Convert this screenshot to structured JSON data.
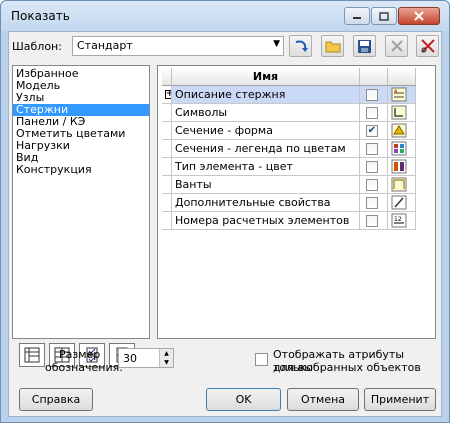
{
  "window": {
    "title": "Показать"
  },
  "template": {
    "label": "Шаблон:",
    "value": "Стандарт"
  },
  "categories": [
    {
      "label": "Избранное",
      "selected": false
    },
    {
      "label": "Модель",
      "selected": false
    },
    {
      "label": "Узлы",
      "selected": false
    },
    {
      "label": "Стержни",
      "selected": true
    },
    {
      "label": "Панели / КЭ",
      "selected": false
    },
    {
      "label": "Отметить цветами",
      "selected": false
    },
    {
      "label": "Нагрузки",
      "selected": false
    },
    {
      "label": "Вид",
      "selected": false
    },
    {
      "label": "Конструкция",
      "selected": false
    }
  ],
  "grid": {
    "header": "Имя",
    "rows": [
      {
        "name": "Описание стержня",
        "checked": false,
        "icon": "bar-description-icon",
        "expandable": true,
        "selected": true
      },
      {
        "name": "Символы",
        "checked": false,
        "icon": "symbols-icon",
        "expandable": false,
        "selected": false
      },
      {
        "name": "Сечение - форма",
        "checked": true,
        "icon": "section-shape-icon",
        "expandable": false,
        "selected": false
      },
      {
        "name": "Сечения - легенда по цветам",
        "checked": false,
        "icon": "section-color-legend-icon",
        "expandable": false,
        "selected": false
      },
      {
        "name": "Тип элемента - цвет",
        "checked": false,
        "icon": "element-type-color-icon",
        "expandable": false,
        "selected": false
      },
      {
        "name": "Ванты",
        "checked": false,
        "icon": "cables-icon",
        "expandable": false,
        "selected": false
      },
      {
        "name": "Дополнительные свойства",
        "checked": false,
        "icon": "additional-properties-icon",
        "expandable": false,
        "selected": false
      },
      {
        "name": "Номера расчетных элементов",
        "checked": false,
        "icon": "calc-element-numbers-icon",
        "expandable": false,
        "selected": false
      }
    ]
  },
  "size": {
    "label_line1": "Размер",
    "label_line2": "обозначения:",
    "value": "30"
  },
  "attributes_option": {
    "line1": "Отображать атрибуты только",
    "line2": "для выбранных объектов",
    "checked": false
  },
  "buttons": {
    "help": "Справка",
    "ok": "OK",
    "cancel": "Отмена",
    "apply": "Применит"
  }
}
